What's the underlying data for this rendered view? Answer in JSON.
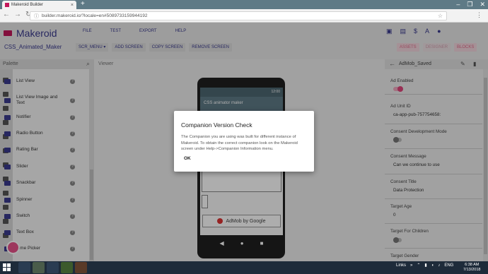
{
  "browser": {
    "tab_title": "Makeroid Builder",
    "tab_close": "×",
    "new_tab": "+",
    "window_controls": [
      "–",
      "❐",
      "✕"
    ],
    "nav": [
      "←",
      "→",
      "↻"
    ],
    "url": "builder.makeroid.io/?locale=en#5089733159944192",
    "star": "☆",
    "menu": "⋮"
  },
  "app": {
    "name": "Makeroid",
    "menu": [
      "FILE",
      "TEST",
      "EXPORT",
      "HELP"
    ],
    "top_icons": [
      "folder-icon",
      "image-icon",
      "money-icon",
      "translate-icon",
      "account-icon"
    ],
    "top_icon_glyphs": [
      "▣",
      "▤",
      "$",
      "A",
      "●"
    ],
    "project_name": "CSS_Animated_Maker",
    "project_buttons": [
      "SCR_MENU ▾",
      "ADD SCREEN",
      "COPY SCREEN",
      "REMOVE SCREEN"
    ],
    "mode_buttons": [
      "ASSETS",
      "DESIGNER",
      "BLOCKS"
    ]
  },
  "palette": {
    "title": "Palette",
    "search_glyph": "🔍",
    "help_glyph": "?",
    "items": [
      {
        "label": "List View"
      },
      {
        "label": "List View Image and Text"
      },
      {
        "label": "Notifier"
      },
      {
        "label": "Radio Button"
      },
      {
        "label": "Rating Bar"
      },
      {
        "label": "Slider"
      },
      {
        "label": "Snackbar"
      },
      {
        "label": "Spinner"
      },
      {
        "label": "Switch"
      },
      {
        "label": "Text Box"
      },
      {
        "label": "Time Picker"
      }
    ]
  },
  "viewer": {
    "label": "Viewer",
    "status_time": "12:00",
    "app_title": "CSS animator maker",
    "admob_text": "AdMob by Google",
    "nav_glyphs": [
      "◀",
      "●",
      "■"
    ]
  },
  "dialog": {
    "title": "Companion Version Check",
    "body": "The Companion you are using was built for different instance of Makeroid. To obtain the correct companion look on the Makeroid screen under Help->Companion Information menu.",
    "ok": "OK"
  },
  "properties": {
    "component": "AdMob_Saved",
    "back_glyph": "←",
    "edit_glyph": "✎",
    "delete_glyph": "🗑",
    "rows": [
      {
        "label": "Ad Enabled",
        "toggle": true
      },
      {
        "label": "Ad Unit ID",
        "value": "ca-app-pub-757754658:"
      },
      {
        "label": "Consent Development Mode",
        "toggle": false
      },
      {
        "label": "Consent Message",
        "value": "Can we continue to use"
      },
      {
        "label": "Consent Title",
        "value": "Data Protection"
      },
      {
        "label": "Target Age",
        "value": "0"
      },
      {
        "label": "Target For Children",
        "toggle": false
      },
      {
        "label": "Target Gender",
        "value": ""
      }
    ]
  },
  "taskbar": {
    "links_label": "Links",
    "tray_glyphs": [
      "»",
      "⌃",
      "▮",
      "◖",
      "♪"
    ],
    "language": "ENG",
    "time": "6:38 AM",
    "date": "7/13/2018"
  },
  "colors": {
    "brand": "#3a3a8e",
    "accent": "#c2185b",
    "toggle_on": "#e0457b"
  }
}
